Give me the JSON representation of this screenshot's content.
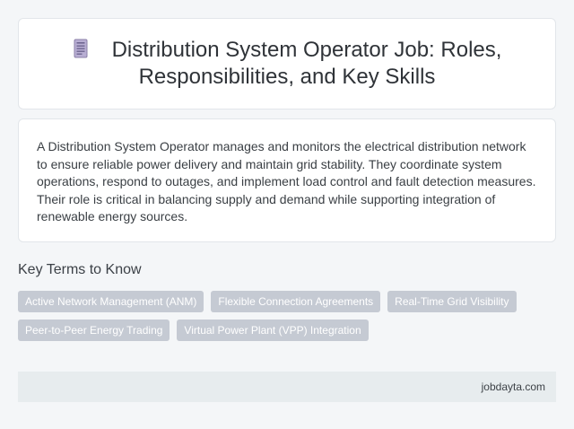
{
  "header": {
    "icon": "document-icon",
    "title": "Distribution System Operator Job: Roles, Responsibilities, and Key Skills"
  },
  "description": {
    "text": "A Distribution System Operator manages and monitors the electrical distribution network to ensure reliable power delivery and maintain grid stability. They coordinate system operations, respond to outages, and implement load control and fault detection measures. Their role is critical in balancing supply and demand while supporting integration of renewable energy sources."
  },
  "key_terms": {
    "heading": "Key Terms to Know",
    "items": [
      "Active Network Management (ANM)",
      "Flexible Connection Agreements",
      "Real-Time Grid Visibility",
      "Peer-to-Peer Energy Trading",
      "Virtual Power Plant (VPP) Integration"
    ]
  },
  "footer": {
    "site": "jobdayta.com"
  },
  "colors": {
    "background": "#f4f6f8",
    "card": "#ffffff",
    "chip": "#c5cad3",
    "footer": "#e7ecee",
    "icon": "#9a8fb8"
  }
}
